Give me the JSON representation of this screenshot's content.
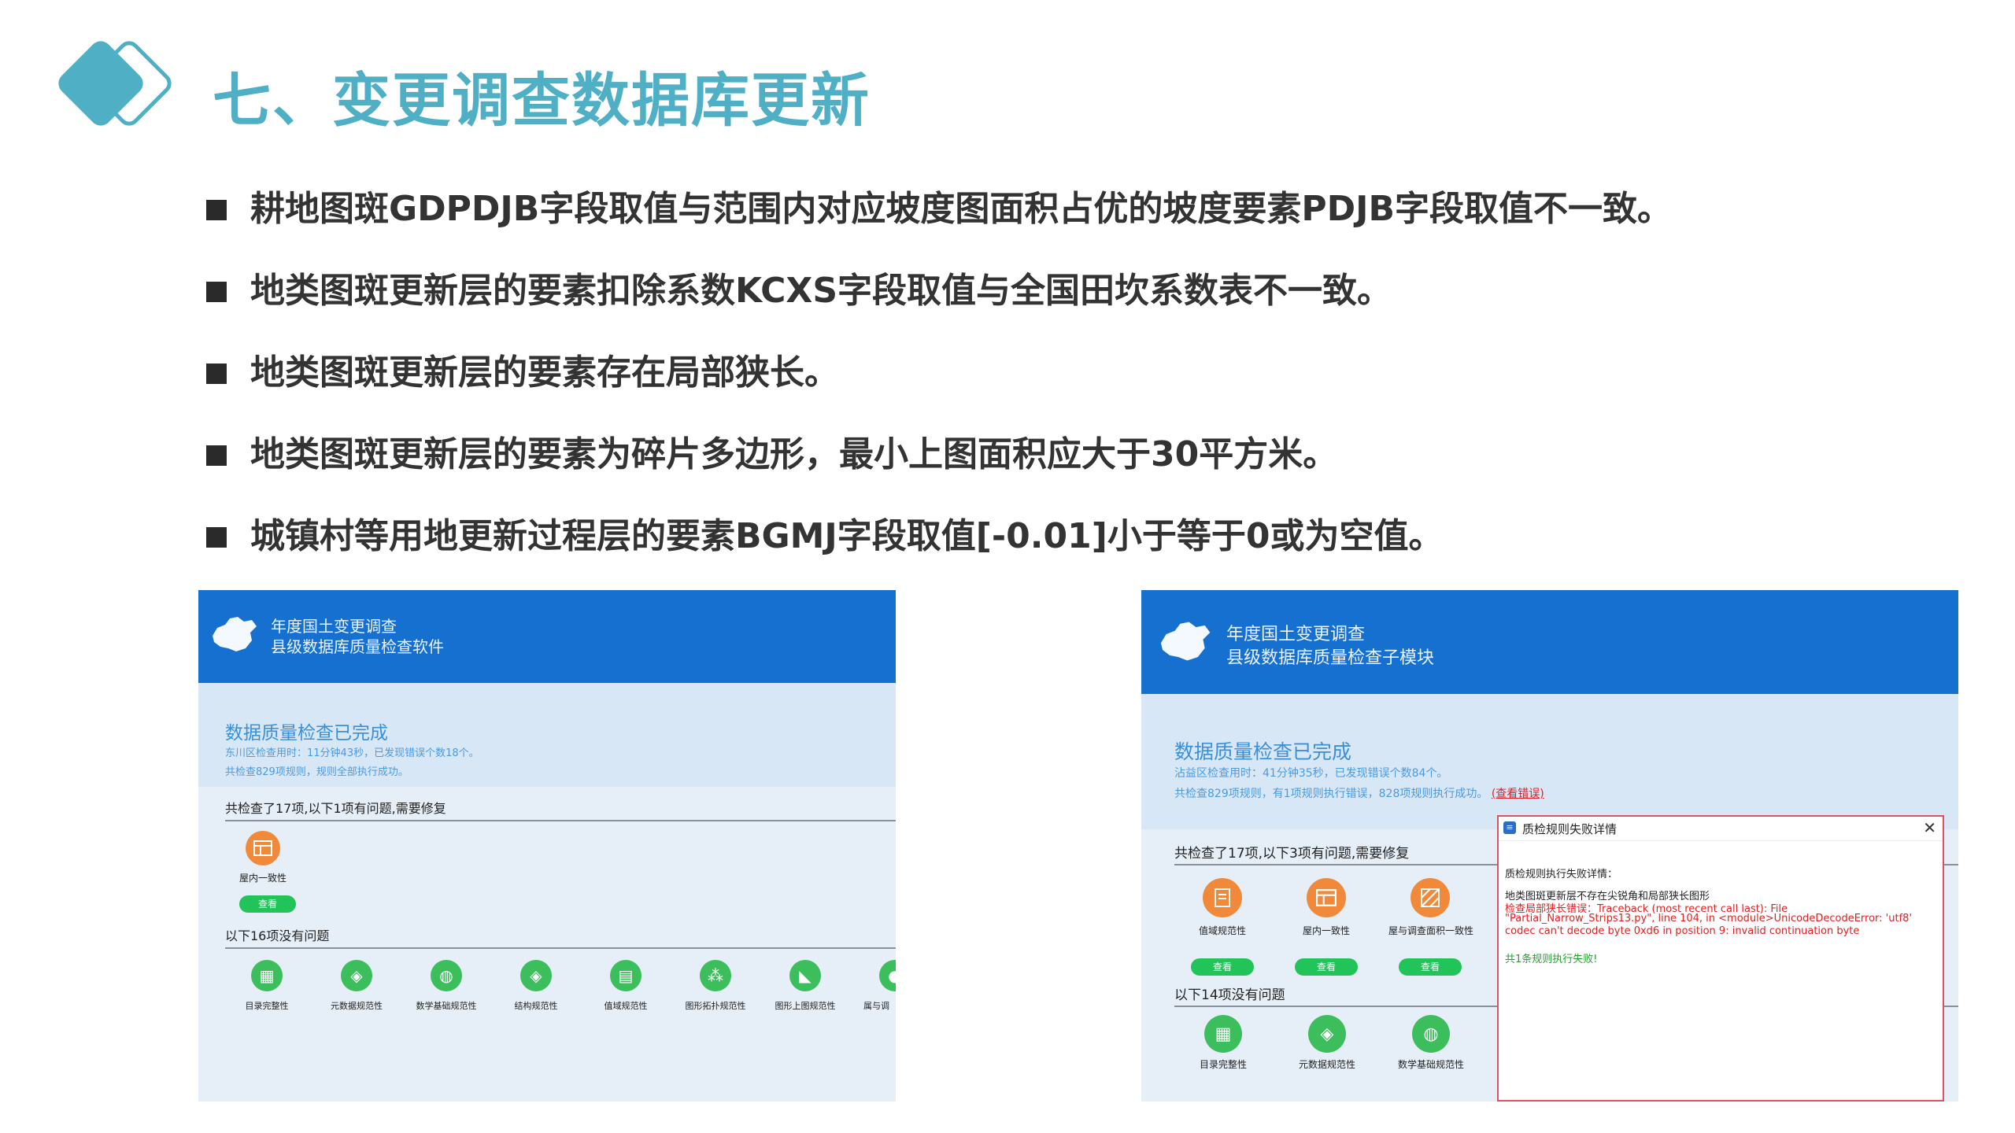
{
  "header": {
    "title": "七、变更调查数据库更新"
  },
  "bullets": [
    "耕地图斑GDPDJB字段取值与范围内对应坡度图面积占优的坡度要素PDJB字段取值不一致。",
    "地类图斑更新层的要素扣除系数KCXS字段取值与全国田坎系数表不一致。",
    "地类图斑更新层的要素存在局部狭长。",
    "地类图斑更新层的要素为碎片多边形，最小上图面积应大于30平方米。",
    "城镇村等用地更新过程层的要素BGMJ字段取值[-0.01]小于等于0或为空值。"
  ],
  "left_app": {
    "title_line1": "年度国土变更调查",
    "title_line2": "县级数据库质量检查软件",
    "status_title": "数据质量检查已完成",
    "status_sub1": "东川区检查用时：11分钟43秒，已发现错误个数18个。",
    "status_sub2": "共检查829项规则，规则全部执行成功。",
    "section1": "共检查了17项,以下1项有问题,需要修复",
    "problem_items": [
      {
        "label": "屋内一致性",
        "icon": "table-icon",
        "button": "查看"
      }
    ],
    "section2": "以下16项没有问题",
    "ok_items": [
      {
        "label": "目录完整性",
        "icon": "grid-icon"
      },
      {
        "label": "元数据规范性",
        "icon": "layers-icon"
      },
      {
        "label": "数学基础规范性",
        "icon": "globe-icon"
      },
      {
        "label": "结构规范性",
        "icon": "layers-icon"
      },
      {
        "label": "值域规范性",
        "icon": "document-icon"
      },
      {
        "label": "图形拓扑规范性",
        "icon": "network-icon"
      },
      {
        "label": "图形上图规范性",
        "icon": "triangle-icon"
      },
      {
        "label": "属与调",
        "icon": "circle-icon"
      }
    ]
  },
  "right_app": {
    "title_line1": "年度国土变更调查",
    "title_line2": "县级数据库质量检查子模块",
    "status_title": "数据质量检查已完成",
    "status_sub1": "沾益区检查用时：41分钟35秒，已发现错误个数84个。",
    "status_sub2": "共检查829项规则，有1项规则执行错误，828项规则执行成功。",
    "error_link": "(查看错误)",
    "section1": "共检查了17项,以下3项有问题,需要修复",
    "problem_items": [
      {
        "label": "值域规范性",
        "icon": "document-icon",
        "button": "查看"
      },
      {
        "label": "屋内一致性",
        "icon": "table-icon",
        "button": "查看"
      },
      {
        "label": "屋与调查面积一致性",
        "icon": "hatch-icon",
        "button": "查看"
      }
    ],
    "section2": "以下14项没有问题",
    "ok_items": [
      {
        "label": "目录完整性",
        "icon": "grid-icon"
      },
      {
        "label": "元数据规范性",
        "icon": "layers-icon"
      },
      {
        "label": "数学基础规范性",
        "icon": "globe-icon"
      }
    ]
  },
  "dialog": {
    "title": "质检规则失败详情",
    "close": "✕",
    "heading": "质检规则执行失败详情：",
    "rule": "地类图斑更新层不存在尖锐角和局部狭长图形",
    "error_prefix": "检查局部狭长错误：",
    "error_line1": "Traceback (most recent call last):  File",
    "error_line2": "\"Partial_Narrow_Strips13.py\", line 104, in <module>UnicodeDecodeError: 'utf8'",
    "error_line3": "codec can't decode byte 0xd6 in position 9: invalid continuation byte",
    "summary": "共1条规则执行失败!"
  },
  "colors": {
    "title": "#4fafc4",
    "header_blue": "#1670d0",
    "ok_green": "#3cbe5c",
    "problem_orange": "#f08a3a",
    "error_red": "#e02020"
  }
}
